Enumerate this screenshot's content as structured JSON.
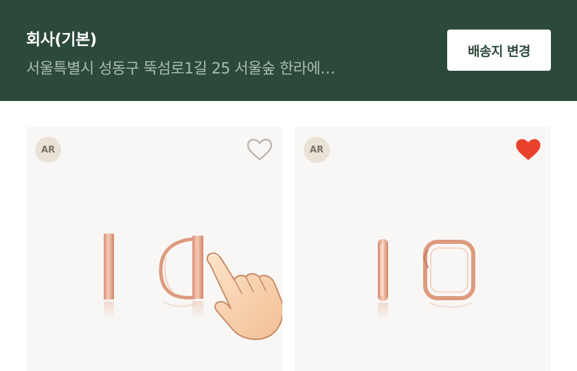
{
  "delivery": {
    "title": "회사(기본)",
    "address": "서울특별시 성동구 뚝섬로1길 25 서울숲 한라에…",
    "change_button": "배송지 변경"
  },
  "products": [
    {
      "badge": "AR",
      "wishlisted": false,
      "icon": "heart-outline-icon"
    },
    {
      "badge": "AR",
      "wishlisted": true,
      "icon": "heart-filled-icon"
    }
  ],
  "colors": {
    "header_bg": "#2c4a3c",
    "heart_active": "#e8412c",
    "rose_gold": "#e4a98f"
  }
}
